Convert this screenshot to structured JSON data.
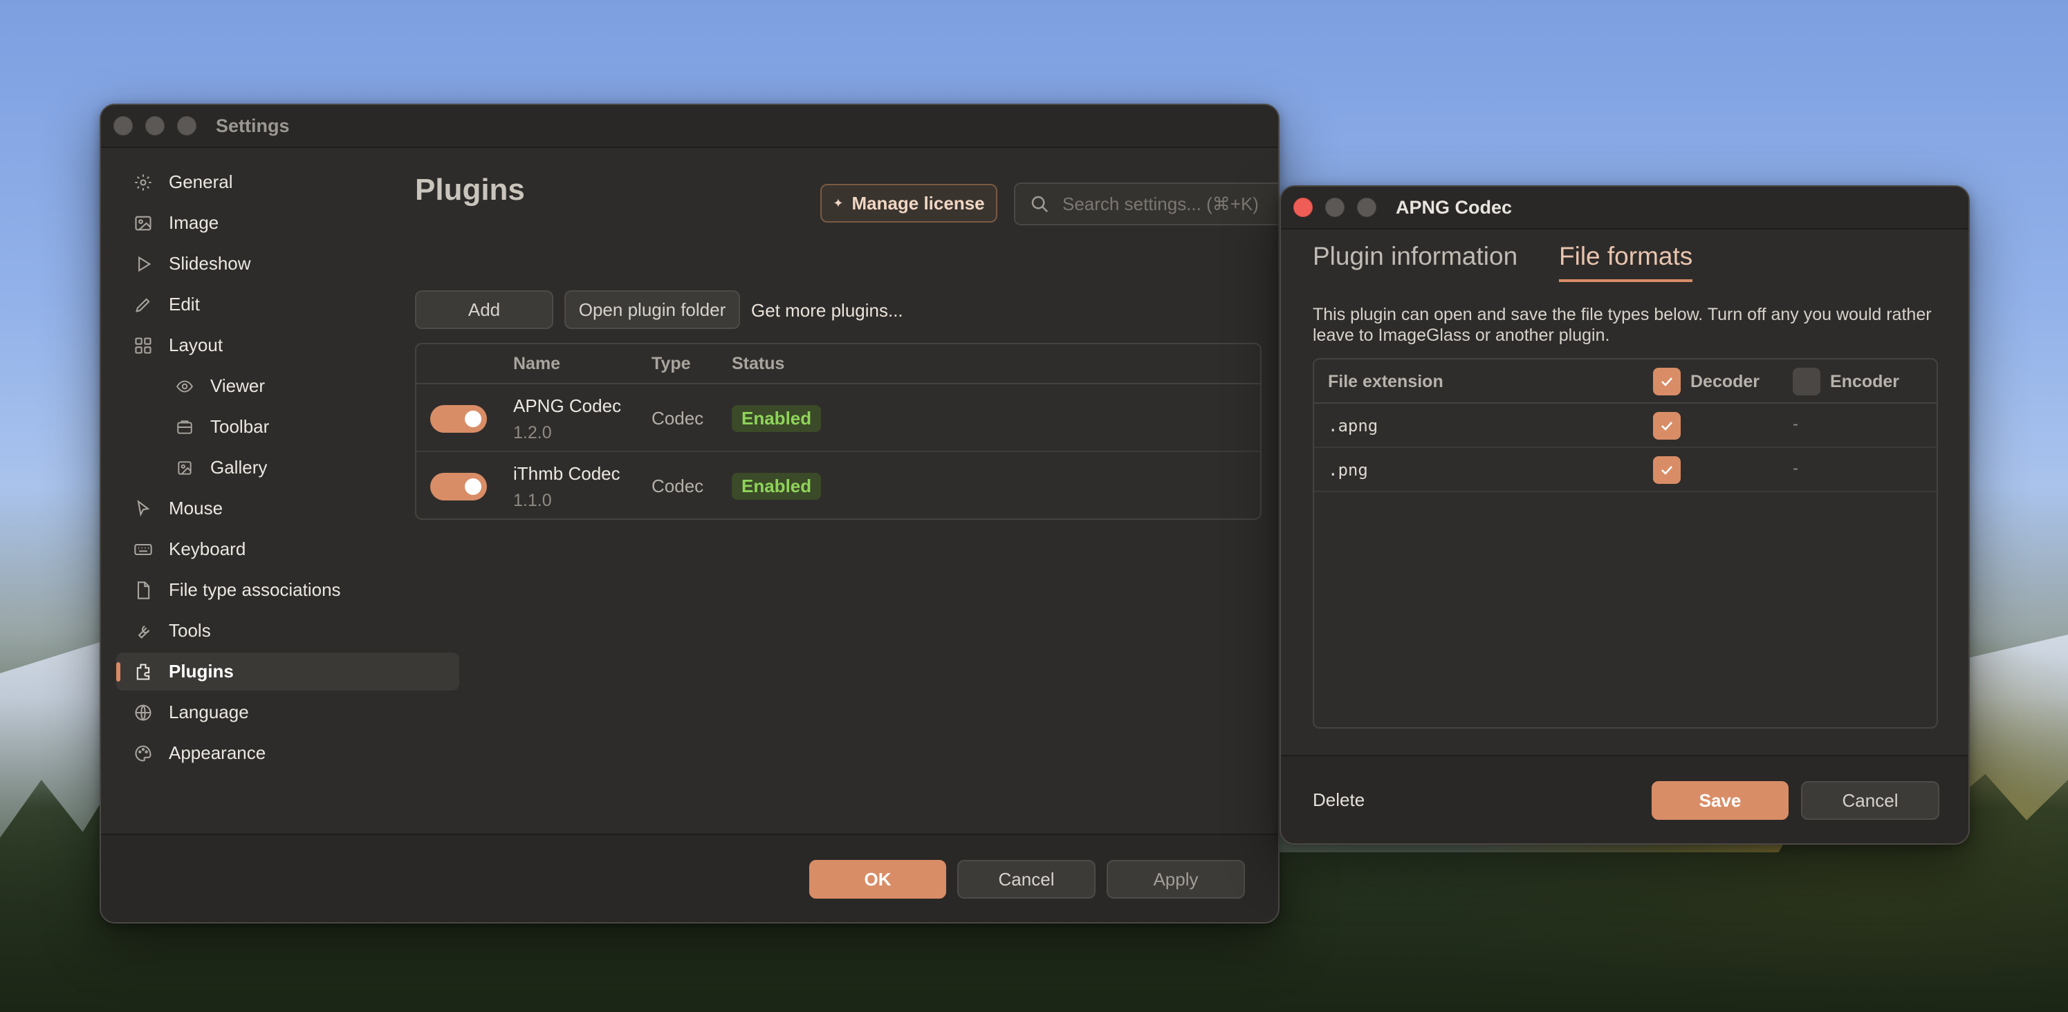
{
  "settings_window": {
    "title": "Settings",
    "sidebar": [
      {
        "label": "General",
        "icon": "gear-icon",
        "sub": false
      },
      {
        "label": "Image",
        "icon": "image-icon",
        "sub": false
      },
      {
        "label": "Slideshow",
        "icon": "play-icon",
        "sub": false
      },
      {
        "label": "Edit",
        "icon": "pencil-icon",
        "sub": false
      },
      {
        "label": "Layout",
        "icon": "grid-icon",
        "sub": false
      },
      {
        "label": "Viewer",
        "icon": "eye-icon",
        "sub": true
      },
      {
        "label": "Toolbar",
        "icon": "toolbar-icon",
        "sub": true
      },
      {
        "label": "Gallery",
        "icon": "gallery-icon",
        "sub": true
      },
      {
        "label": "Mouse",
        "icon": "cursor-icon",
        "sub": false
      },
      {
        "label": "Keyboard",
        "icon": "keyboard-icon",
        "sub": false
      },
      {
        "label": "File type associations",
        "icon": "file-icon",
        "sub": false
      },
      {
        "label": "Tools",
        "icon": "wrench-icon",
        "sub": false
      },
      {
        "label": "Plugins",
        "icon": "plugin-icon",
        "sub": false,
        "active": true
      },
      {
        "label": "Language",
        "icon": "globe-icon",
        "sub": false
      },
      {
        "label": "Appearance",
        "icon": "palette-icon",
        "sub": false
      }
    ],
    "page_title": "Plugins",
    "manage_license": "Manage license",
    "search_placeholder": "Search settings... (⌘+K)",
    "add_label": "Add",
    "open_folder_label": "Open plugin folder",
    "get_more_label": "Get more plugins...",
    "table": {
      "headers": {
        "name": "Name",
        "type": "Type",
        "status": "Status"
      },
      "rows": [
        {
          "name": "APNG Codec",
          "version": "1.2.0",
          "type": "Codec",
          "status": "Enabled",
          "enabled": true
        },
        {
          "name": "iThmb Codec",
          "version": "1.1.0",
          "type": "Codec",
          "status": "Enabled",
          "enabled": true
        }
      ]
    },
    "footer": {
      "ok": "OK",
      "cancel": "Cancel",
      "apply": "Apply"
    }
  },
  "apng_window": {
    "title": "APNG Codec",
    "tabs": [
      "Plugin information",
      "File formats"
    ],
    "active_tab": "File formats",
    "description": "This plugin can open and save the file types below. Turn off any you would rather leave to ImageGlass or another plugin.",
    "table": {
      "headers": {
        "extension": "File extension",
        "decoder": "Decoder",
        "encoder": "Encoder"
      },
      "decoder_all": true,
      "encoder_all": false,
      "rows": [
        {
          "ext": ".apng",
          "decoder": true,
          "encoder": "-"
        },
        {
          "ext": ".png",
          "decoder": true,
          "encoder": "-"
        }
      ]
    },
    "footer": {
      "delete": "Delete",
      "save": "Save",
      "cancel": "Cancel"
    }
  },
  "colors": {
    "accent": "#d98d67",
    "enabled_text": "#8fd45a",
    "window_bg": "#2e2c2a"
  }
}
